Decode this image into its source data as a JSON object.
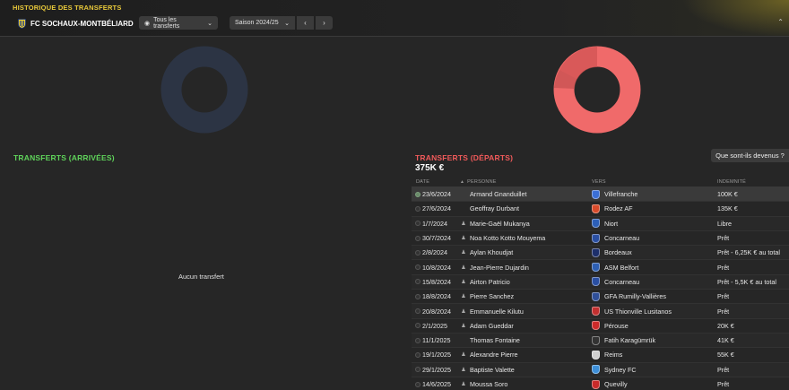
{
  "header": {
    "title": "HISTORIQUE DES TRANSFERTS",
    "club_name": "FC SOCHAUX-MONTBÉLIARD",
    "filter_label": "Tous les transferts",
    "season_label": "Saison 2024/25"
  },
  "arrivals": {
    "title": "TRANSFERTS (ARRIVÉES)",
    "empty_text": "Aucun transfert"
  },
  "departures": {
    "title": "TRANSFERTS (DÉPARTS)",
    "total": "375K €",
    "fate_button": "Que sont-ils devenus ?",
    "columns": {
      "date": "DATE",
      "person": "PERSONNE",
      "to": "VERS",
      "fee": "INDEMNITÉ"
    },
    "rows": [
      {
        "date": "23/6/2024",
        "person": "Armand Gnanduillet",
        "loan": false,
        "to": "Villefranche",
        "fee": "100K €",
        "badge": "#3b6fd6"
      },
      {
        "date": "27/6/2024",
        "person": "Geoffray Durbant",
        "loan": false,
        "to": "Rodez AF",
        "fee": "135K €",
        "badge": "#d94b2b"
      },
      {
        "date": "1/7/2024",
        "person": "Marie-Gaël Mukanya",
        "loan": true,
        "to": "Niort",
        "fee": "Libre",
        "badge": "#2c5fb8"
      },
      {
        "date": "30/7/2024",
        "person": "Noa Kotto Kotto Mouyema",
        "loan": true,
        "to": "Concarneau",
        "fee": "Prêt",
        "badge": "#2a4fa3"
      },
      {
        "date": "2/8/2024",
        "person": "Aylan Khoudjat",
        "loan": true,
        "to": "Bordeaux",
        "fee": "Prêt - 6,25K € au total",
        "badge": "#1d2f6b"
      },
      {
        "date": "10/8/2024",
        "person": "Jean-Pierre Dujardin",
        "loan": true,
        "to": "ASM Belfort",
        "fee": "Prêt",
        "badge": "#2d5fb3"
      },
      {
        "date": "15/8/2024",
        "person": "Airton Patricio",
        "loan": true,
        "to": "Concarneau",
        "fee": "Prêt - 5,5K € au total",
        "badge": "#2a4fa3"
      },
      {
        "date": "18/8/2024",
        "person": "Pierre Sanchez",
        "loan": true,
        "to": "GFA Rumilly-Vallières",
        "fee": "Prêt",
        "badge": "#2f4f99"
      },
      {
        "date": "20/8/2024",
        "person": "Emmanuelle Kilutu",
        "loan": true,
        "to": "US Thionville Lusitanos",
        "fee": "Prêt",
        "badge": "#c23030"
      },
      {
        "date": "2/1/2025",
        "person": "Adam Gueddar",
        "loan": true,
        "to": "Pérouse",
        "fee": "20K €",
        "badge": "#cc2a2a"
      },
      {
        "date": "11/1/2025",
        "person": "Thomas Fontaine",
        "loan": false,
        "to": "Fatih Karagümrük",
        "fee": "41K €",
        "badge": "#333333"
      },
      {
        "date": "19/1/2025",
        "person": "Alexandre Pierre",
        "loan": true,
        "to": "Reims",
        "fee": "55K €",
        "badge": "#cfcfcf"
      },
      {
        "date": "29/1/2025",
        "person": "Baptiste Valette",
        "loan": true,
        "to": "Sydney FC",
        "fee": "Prêt",
        "badge": "#3d8fd9"
      },
      {
        "date": "14/6/2025",
        "person": "Moussa Soro",
        "loan": true,
        "to": "Quevilly",
        "fee": "Prêt",
        "badge": "#c92a2a"
      }
    ]
  },
  "colors": {
    "accent_gold": "#e9c93a",
    "arrivals_green": "#5fd35a",
    "departures_red": "#f05a5a",
    "donut_left": "#2c3444",
    "donut_right": "#f06a6a"
  }
}
